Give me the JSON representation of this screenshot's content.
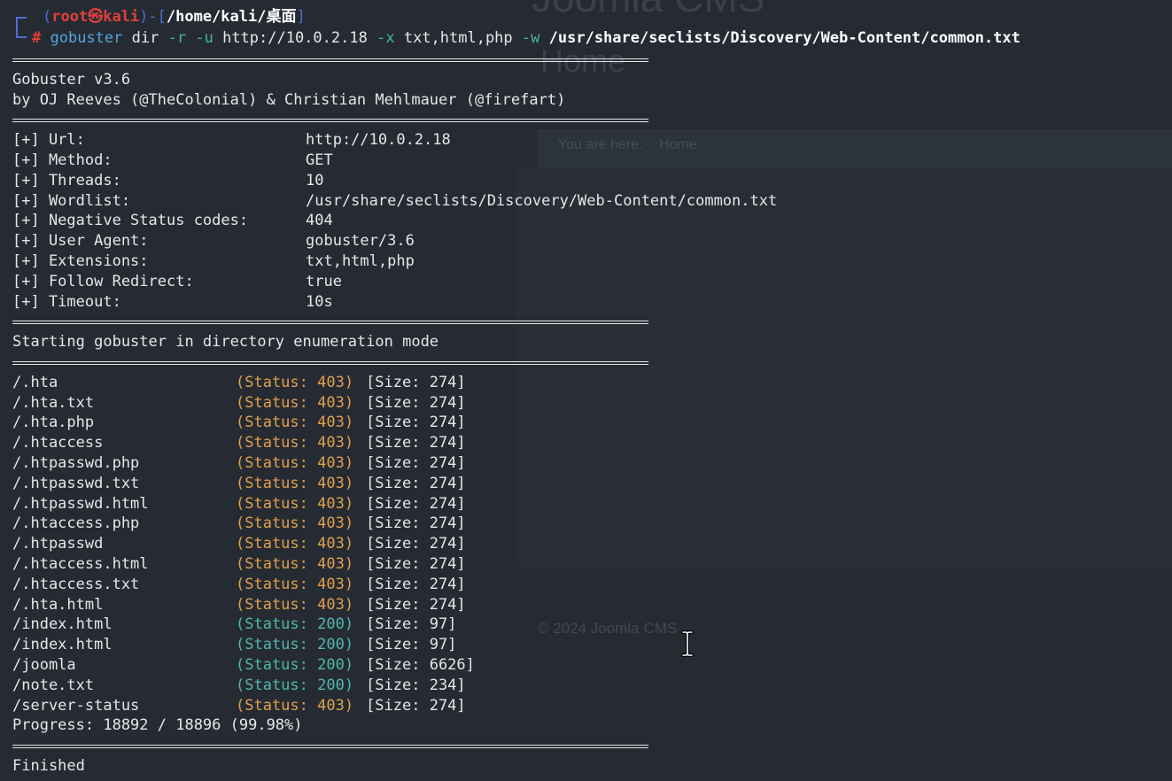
{
  "background_page": {
    "title": "Joomla CMS",
    "home_heading": "Home",
    "breadcrumb": [
      "You are here:",
      "Home"
    ],
    "footer": "© 2024 Joomla CMS"
  },
  "prompt": {
    "user": "root",
    "at_symbol": "㉿",
    "host": "kali",
    "path": "/home/kali/桌面",
    "symbol": "#",
    "command": "gobuster",
    "subcommand": "dir",
    "flag_r": "-r",
    "flag_u": "-u",
    "url": "http://10.0.2.18",
    "flag_x": "-x",
    "extensions": "txt,html,php",
    "flag_w": "-w",
    "wordlist": "/usr/share/seclists/Discovery/Web-Content/common.txt"
  },
  "banner": {
    "version": "Gobuster v3.6",
    "authors": "by OJ Reeves (@TheColonial) & Christian Mehlmauer (@firefart)"
  },
  "config": [
    {
      "key": "[+] Url:",
      "value": "http://10.0.2.18"
    },
    {
      "key": "[+] Method:",
      "value": "GET"
    },
    {
      "key": "[+] Threads:",
      "value": "10"
    },
    {
      "key": "[+] Wordlist:",
      "value": "/usr/share/seclists/Discovery/Web-Content/common.txt"
    },
    {
      "key": "[+] Negative Status codes:",
      "value": "404"
    },
    {
      "key": "[+] User Agent:",
      "value": "gobuster/3.6"
    },
    {
      "key": "[+] Extensions:",
      "value": "txt,html,php"
    },
    {
      "key": "[+] Follow Redirect:",
      "value": "true"
    },
    {
      "key": "[+] Timeout:",
      "value": "10s"
    }
  ],
  "start_message": "Starting gobuster in directory enumeration mode",
  "results": [
    {
      "path": "/.hta",
      "status": "(Status: 403)",
      "code": 403,
      "size": "[Size: 274]"
    },
    {
      "path": "/.hta.txt",
      "status": "(Status: 403)",
      "code": 403,
      "size": "[Size: 274]"
    },
    {
      "path": "/.hta.php",
      "status": "(Status: 403)",
      "code": 403,
      "size": "[Size: 274]"
    },
    {
      "path": "/.htaccess",
      "status": "(Status: 403)",
      "code": 403,
      "size": "[Size: 274]"
    },
    {
      "path": "/.htpasswd.php",
      "status": "(Status: 403)",
      "code": 403,
      "size": "[Size: 274]"
    },
    {
      "path": "/.htpasswd.txt",
      "status": "(Status: 403)",
      "code": 403,
      "size": "[Size: 274]"
    },
    {
      "path": "/.htpasswd.html",
      "status": "(Status: 403)",
      "code": 403,
      "size": "[Size: 274]"
    },
    {
      "path": "/.htaccess.php",
      "status": "(Status: 403)",
      "code": 403,
      "size": "[Size: 274]"
    },
    {
      "path": "/.htpasswd",
      "status": "(Status: 403)",
      "code": 403,
      "size": "[Size: 274]"
    },
    {
      "path": "/.htaccess.html",
      "status": "(Status: 403)",
      "code": 403,
      "size": "[Size: 274]"
    },
    {
      "path": "/.htaccess.txt",
      "status": "(Status: 403)",
      "code": 403,
      "size": "[Size: 274]"
    },
    {
      "path": "/.hta.html",
      "status": "(Status: 403)",
      "code": 403,
      "size": "[Size: 274]"
    },
    {
      "path": "/index.html",
      "status": "(Status: 200)",
      "code": 200,
      "size": "[Size: 97]"
    },
    {
      "path": "/index.html",
      "status": "(Status: 200)",
      "code": 200,
      "size": "[Size: 97]"
    },
    {
      "path": "/joomla",
      "status": "(Status: 200)",
      "code": 200,
      "size": "[Size: 6626]"
    },
    {
      "path": "/note.txt",
      "status": "(Status: 200)",
      "code": 200,
      "size": "[Size: 234]"
    },
    {
      "path": "/server-status",
      "status": "(Status: 403)",
      "code": 403,
      "size": "[Size: 274]"
    }
  ],
  "progress": "Progress: 18892 / 18896 (99.98%)",
  "finished": "Finished",
  "colors": {
    "background": "#262b33",
    "status_403": "#e1a04c",
    "status_200": "#4fb8ab",
    "prompt_user": "#e0403a",
    "prompt_frame": "#4f6bd6",
    "command": "#54a4d8"
  }
}
